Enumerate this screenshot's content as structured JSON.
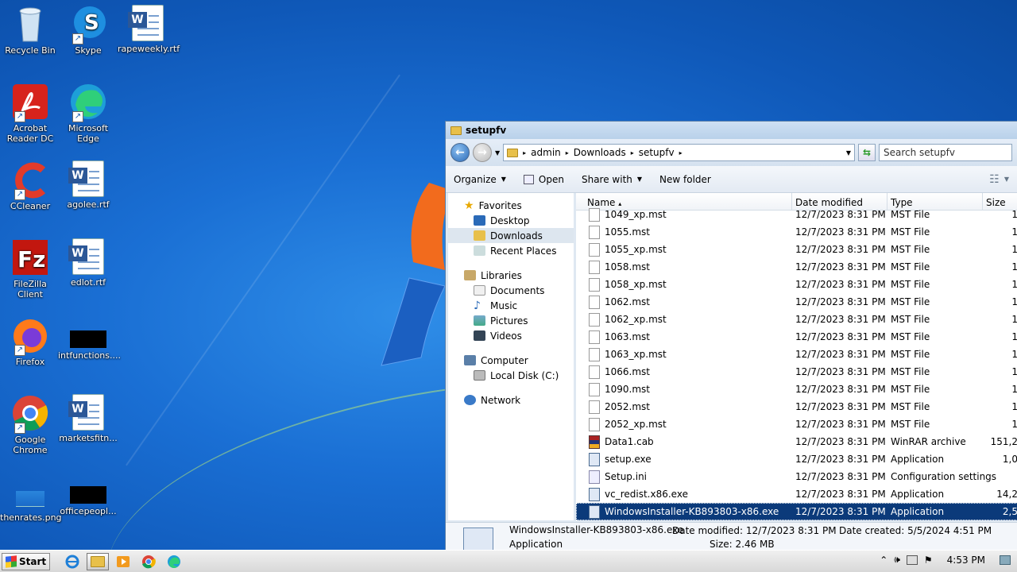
{
  "desktop": {
    "icons": [
      {
        "label": "Recycle Bin",
        "icon": "recycle-bin-icon"
      },
      {
        "label": "Skype",
        "icon": "skype-icon"
      },
      {
        "label": "rapeweekly.rtf",
        "icon": "word-document-icon"
      },
      {
        "label": "Acrobat Reader DC",
        "icon": "acrobat-icon"
      },
      {
        "label": "Microsoft Edge",
        "icon": "edge-icon"
      },
      {
        "label": "CCleaner",
        "icon": "ccleaner-icon"
      },
      {
        "label": "agolee.rtf",
        "icon": "word-document-icon"
      },
      {
        "label": "FileZilla Client",
        "icon": "filezilla-icon"
      },
      {
        "label": "edlot.rtf",
        "icon": "word-document-icon"
      },
      {
        "label": "Firefox",
        "icon": "firefox-icon"
      },
      {
        "label": "intfunctions....",
        "icon": "black-thumbnail"
      },
      {
        "label": "Google Chrome",
        "icon": "chrome-icon"
      },
      {
        "label": "marketsfitn...",
        "icon": "word-document-icon"
      },
      {
        "label": "thenrates.png",
        "icon": "image-thumbnail"
      },
      {
        "label": "officepeopl...",
        "icon": "black-thumbnail"
      }
    ]
  },
  "explorer": {
    "title": "setupfv",
    "address": {
      "crumbs": [
        "admin",
        "Downloads",
        "setupfv"
      ]
    },
    "search": {
      "placeholder": "Search setupfv"
    },
    "toolbar": {
      "organize": "Organize",
      "open": "Open",
      "share": "Share with",
      "new_folder": "New folder"
    },
    "nav": {
      "favorites": "Favorites",
      "desktop": "Desktop",
      "downloads": "Downloads",
      "recent": "Recent Places",
      "libraries": "Libraries",
      "documents": "Documents",
      "music": "Music",
      "pictures": "Pictures",
      "videos": "Videos",
      "computer": "Computer",
      "local_disk": "Local Disk (C:)",
      "network": "Network"
    },
    "columns": {
      "name": "Name",
      "date": "Date modified",
      "type": "Type",
      "size": "Size"
    },
    "files": [
      {
        "name": "1049_xp.mst",
        "date": "12/7/2023 8:31 PM",
        "type": "MST File",
        "size": "1"
      },
      {
        "name": "1055.mst",
        "date": "12/7/2023 8:31 PM",
        "type": "MST File",
        "size": "1"
      },
      {
        "name": "1055_xp.mst",
        "date": "12/7/2023 8:31 PM",
        "type": "MST File",
        "size": "1"
      },
      {
        "name": "1058.mst",
        "date": "12/7/2023 8:31 PM",
        "type": "MST File",
        "size": "1"
      },
      {
        "name": "1058_xp.mst",
        "date": "12/7/2023 8:31 PM",
        "type": "MST File",
        "size": "1"
      },
      {
        "name": "1062.mst",
        "date": "12/7/2023 8:31 PM",
        "type": "MST File",
        "size": "1"
      },
      {
        "name": "1062_xp.mst",
        "date": "12/7/2023 8:31 PM",
        "type": "MST File",
        "size": "1"
      },
      {
        "name": "1063.mst",
        "date": "12/7/2023 8:31 PM",
        "type": "MST File",
        "size": "1"
      },
      {
        "name": "1063_xp.mst",
        "date": "12/7/2023 8:31 PM",
        "type": "MST File",
        "size": "1"
      },
      {
        "name": "1066.mst",
        "date": "12/7/2023 8:31 PM",
        "type": "MST File",
        "size": "1"
      },
      {
        "name": "1090.mst",
        "date": "12/7/2023 8:31 PM",
        "type": "MST File",
        "size": "1"
      },
      {
        "name": "2052.mst",
        "date": "12/7/2023 8:31 PM",
        "type": "MST File",
        "size": "1"
      },
      {
        "name": "2052_xp.mst",
        "date": "12/7/2023 8:31 PM",
        "type": "MST File",
        "size": "1"
      },
      {
        "name": "Data1.cab",
        "date": "12/7/2023 8:31 PM",
        "type": "WinRAR archive",
        "size": "151,2"
      },
      {
        "name": "setup.exe",
        "date": "12/7/2023 8:31 PM",
        "type": "Application",
        "size": "1,0"
      },
      {
        "name": "Setup.ini",
        "date": "12/7/2023 8:31 PM",
        "type": "Configuration settings",
        "size": ""
      },
      {
        "name": "vc_redist.x86.exe",
        "date": "12/7/2023 8:31 PM",
        "type": "Application",
        "size": "14,2"
      },
      {
        "name": "WindowsInstaller-KB893803-x86.exe",
        "date": "12/7/2023 8:31 PM",
        "type": "Application",
        "size": "2,5"
      }
    ],
    "details": {
      "name": "WindowsInstaller-KB893803-x86.exe",
      "modified": "Date modified: 12/7/2023 8:31 PM",
      "created": "Date created: 5/5/2024 4:51 PM",
      "type": "Application",
      "size": "Size: 2.46 MB"
    }
  },
  "taskbar": {
    "start": "Start",
    "time": "4:53 PM"
  }
}
